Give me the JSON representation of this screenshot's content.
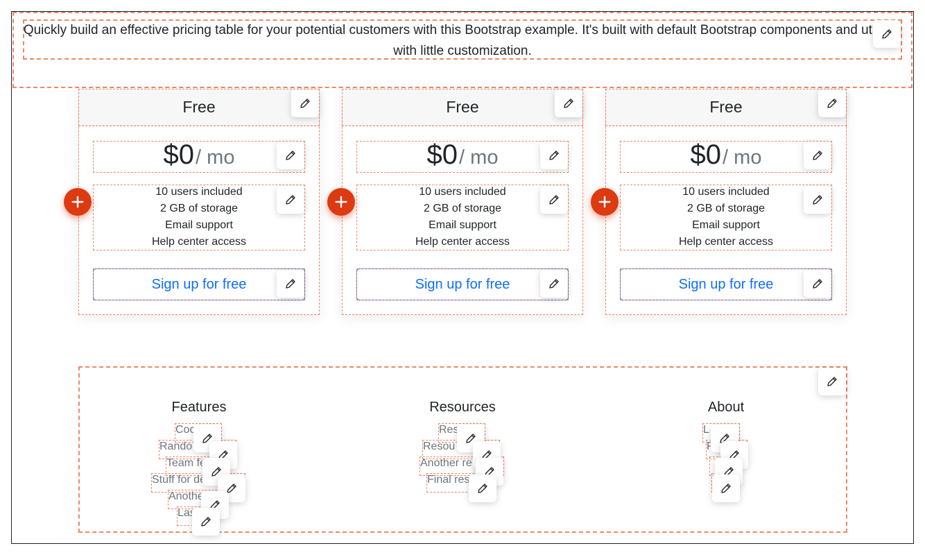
{
  "intro": {
    "text": "Quickly build an effective pricing table for your potential customers with this Bootstrap example. It's built with default Bootstrap components and utilities with little customization."
  },
  "plans": [
    {
      "title": "Free",
      "price": "$0",
      "period": "/ mo",
      "features": [
        "10 users included",
        "2 GB of storage",
        "Email support",
        "Help center access"
      ],
      "button": "Sign up for free"
    },
    {
      "title": "Free",
      "price": "$0",
      "period": "/ mo",
      "features": [
        "10 users included",
        "2 GB of storage",
        "Email support",
        "Help center access"
      ],
      "button": "Sign up for free"
    },
    {
      "title": "Free",
      "price": "$0",
      "period": "/ mo",
      "features": [
        "10 users included",
        "2 GB of storage",
        "Email support",
        "Help center access"
      ],
      "button": "Sign up for free"
    }
  ],
  "footer": {
    "columns": [
      {
        "title": "Features",
        "links": [
          "Coo",
          "Rando",
          "Team fe",
          "Stuff for de",
          "Anothe",
          "Las"
        ]
      },
      {
        "title": "Resources",
        "links": [
          "Res",
          "Resou",
          "Another re",
          "Final res"
        ]
      },
      {
        "title": "About",
        "links": [
          "L",
          "P"
        ]
      }
    ]
  },
  "icons": {
    "edit": "pencil-icon",
    "add": "plus-icon"
  },
  "colors": {
    "accent": "#dd3a12",
    "dashed_outline": "#ee8866",
    "link": "#0d6efd",
    "muted": "#6c757d"
  }
}
